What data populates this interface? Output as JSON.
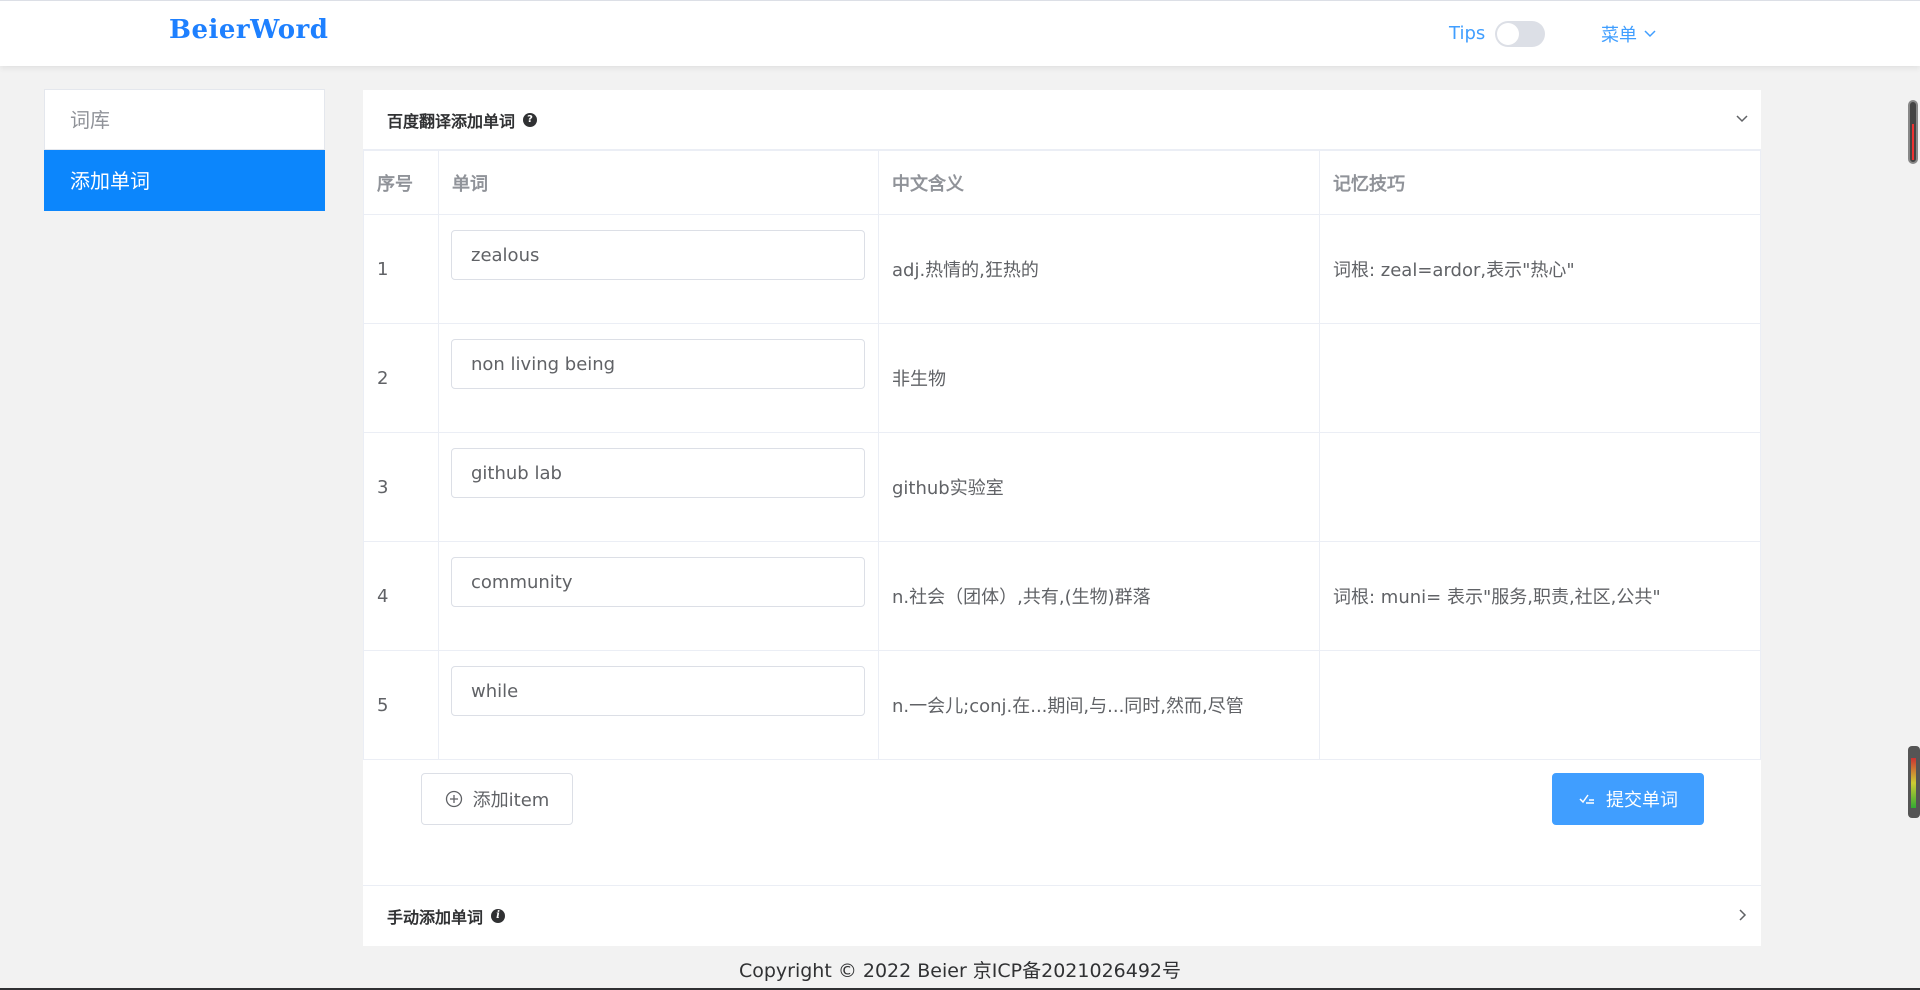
{
  "app": {
    "logo": "BeierWord"
  },
  "header": {
    "tips_label": "Tips",
    "tips_enabled": false,
    "menu_label": "菜单"
  },
  "sidebar": {
    "items": [
      {
        "label": "词库",
        "active": false
      },
      {
        "label": "添加单词",
        "active": true
      }
    ]
  },
  "baidu_panel": {
    "title": "百度翻译添加单词",
    "help_icon": "question-circle-icon",
    "expanded": true,
    "table": {
      "headers": {
        "index": "序号",
        "word": "单词",
        "meaning": "中文含义",
        "tip": "记忆技巧"
      },
      "rows": [
        {
          "index": "1",
          "word": "zealous",
          "meaning": "adj.热情的,狂热的",
          "tip": "词根: zeal=ardor,表示\"热心\""
        },
        {
          "index": "2",
          "word": "non living being",
          "meaning": "非生物",
          "tip": ""
        },
        {
          "index": "3",
          "word": "github lab",
          "meaning": "github实验室",
          "tip": ""
        },
        {
          "index": "4",
          "word": "community",
          "meaning": "n.社会（团体）,共有,(生物)群落",
          "tip": "词根: muni= 表示\"服务,职责,社区,公共\""
        },
        {
          "index": "5",
          "word": "while",
          "meaning": "n.一会儿;conj.在...期间,与...同时,然而,尽管",
          "tip": ""
        }
      ]
    },
    "add_button": "添加item",
    "submit_button": "提交单词"
  },
  "manual_panel": {
    "title": "手动添加单词",
    "info_icon": "info-circle-icon",
    "expanded": false
  },
  "footer": {
    "copyright": "Copyright © 2022 Beier 京ICP备2021026492号"
  },
  "colors": {
    "primary": "#409eff",
    "active_sidebar": "#0c86fc",
    "logo": "#1e80ff"
  }
}
